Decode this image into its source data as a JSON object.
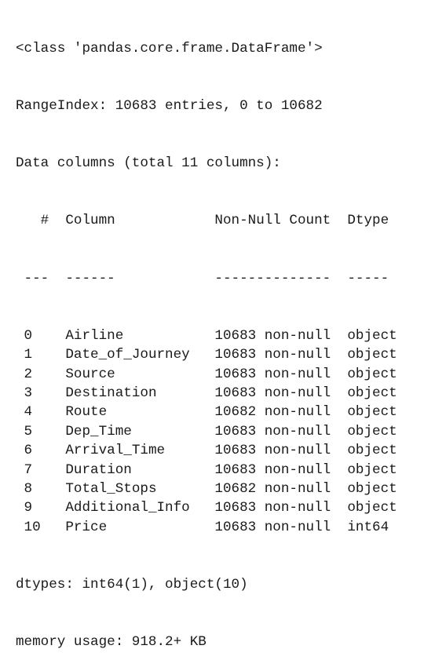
{
  "header": {
    "class_line": "<class 'pandas.core.frame.DataFrame'>",
    "range_index": "RangeIndex: 10683 entries, 0 to 10682",
    "data_columns": "Data columns (total 11 columns):"
  },
  "table": {
    "column_headers": [
      "#",
      "Column",
      "Non-Null Count",
      "Dtype"
    ],
    "separators": [
      "---",
      "------",
      "--------------",
      "-----"
    ],
    "rows": [
      [
        "0",
        "Airline",
        "10683 non-null",
        "object"
      ],
      [
        "1",
        "Date_of_Journey",
        "10683 non-null",
        "object"
      ],
      [
        "2",
        "Source",
        "10683 non-null",
        "object"
      ],
      [
        "3",
        "Destination",
        "10683 non-null",
        "object"
      ],
      [
        "4",
        "Route",
        "10682 non-null",
        "object"
      ],
      [
        "5",
        "Dep_Time",
        "10683 non-null",
        "object"
      ],
      [
        "6",
        "Arrival_Time",
        "10683 non-null",
        "object"
      ],
      [
        "7",
        "Duration",
        "10683 non-null",
        "object"
      ],
      [
        "8",
        "Total_Stops",
        "10682 non-null",
        "object"
      ],
      [
        "9",
        "Additional_Info",
        "10683 non-null",
        "object"
      ],
      [
        "10",
        "Price",
        "10683 non-null",
        "int64"
      ]
    ]
  },
  "footer": {
    "dtypes": "dtypes: int64(1), object(10)",
    "memory_usage": "memory usage: 918.2+ KB"
  }
}
